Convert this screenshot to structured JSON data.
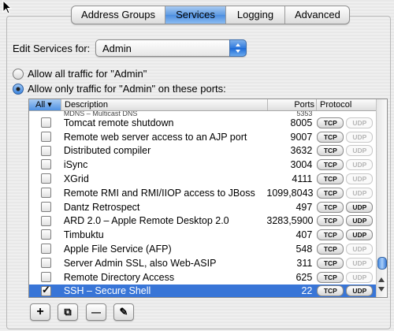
{
  "tabs": [
    {
      "label": "Address Groups",
      "active": false
    },
    {
      "label": "Services",
      "active": true
    },
    {
      "label": "Logging",
      "active": false
    },
    {
      "label": "Advanced",
      "active": false
    }
  ],
  "edit_services": {
    "label": "Edit Services for:",
    "selected": "Admin"
  },
  "radios": [
    {
      "label": "Allow all traffic for \"Admin\"",
      "selected": false
    },
    {
      "label": "Allow only traffic for \"Admin\" on these ports:",
      "selected": true
    }
  ],
  "table": {
    "columns": {
      "all": "All",
      "description": "Description",
      "ports": "Ports",
      "protocol": "Protocol"
    },
    "protocol_labels": {
      "tcp": "TCP",
      "udp": "UDP"
    },
    "partial_row": {
      "description": "MDNS – Multicast DNS",
      "ports": "5353"
    },
    "rows": [
      {
        "checked": false,
        "description": "Tomcat remote shutdown",
        "ports": "8005",
        "tcp": true,
        "udp": false,
        "selected": false
      },
      {
        "checked": false,
        "description": "Remote web server access to an AJP port",
        "ports": "9007",
        "tcp": true,
        "udp": false,
        "selected": false
      },
      {
        "checked": false,
        "description": "Distributed compiler",
        "ports": "3632",
        "tcp": true,
        "udp": false,
        "selected": false
      },
      {
        "checked": false,
        "description": "iSync",
        "ports": "3004",
        "tcp": true,
        "udp": false,
        "selected": false
      },
      {
        "checked": false,
        "description": "XGrid",
        "ports": "4111",
        "tcp": true,
        "udp": false,
        "selected": false
      },
      {
        "checked": false,
        "description": "Remote RMI and RMI/IIOP access to JBoss",
        "ports": "1099,8043",
        "tcp": true,
        "udp": false,
        "selected": false
      },
      {
        "checked": false,
        "description": "Dantz Retrospect",
        "ports": "497",
        "tcp": true,
        "udp": true,
        "selected": false
      },
      {
        "checked": false,
        "description": "ARD 2.0 – Apple Remote Desktop 2.0",
        "ports": "3283,5900",
        "tcp": true,
        "udp": true,
        "selected": false
      },
      {
        "checked": false,
        "description": "Timbuktu",
        "ports": "407",
        "tcp": true,
        "udp": true,
        "selected": false
      },
      {
        "checked": false,
        "description": "Apple File Service (AFP)",
        "ports": "548",
        "tcp": true,
        "udp": false,
        "selected": false
      },
      {
        "checked": false,
        "description": "Server Admin SSL, also Web-ASIP",
        "ports": "311",
        "tcp": true,
        "udp": false,
        "selected": false
      },
      {
        "checked": false,
        "description": "Remote Directory Access",
        "ports": "625",
        "tcp": true,
        "udp": false,
        "selected": false
      },
      {
        "checked": true,
        "description": "SSH – Secure Shell",
        "ports": "22",
        "tcp": true,
        "udp": true,
        "selected": true
      }
    ]
  },
  "buttons": [
    {
      "icon": "plus-icon",
      "glyph": "+"
    },
    {
      "icon": "duplicate-icon",
      "glyph": "⧉"
    },
    {
      "icon": "minus-icon",
      "glyph": "—"
    },
    {
      "icon": "pencil-icon",
      "glyph": "✎"
    }
  ],
  "colors": {
    "selection": "#3875d7",
    "accent": "#4c8ee0"
  }
}
